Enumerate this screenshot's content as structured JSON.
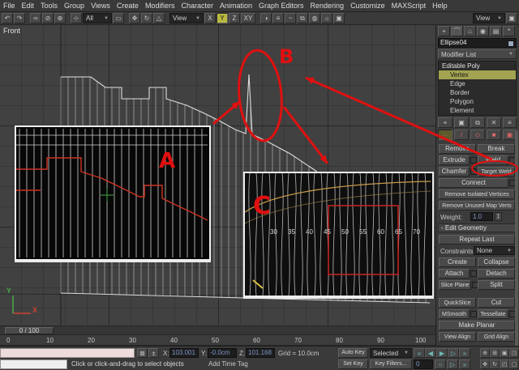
{
  "menu": {
    "items": [
      "File",
      "Edit",
      "Tools",
      "Group",
      "Views",
      "Create",
      "Modifiers",
      "Character",
      "Animation",
      "Graph Editors",
      "Rendering",
      "Customize",
      "MAXScript",
      "Help"
    ]
  },
  "toolbar": {
    "selection_filter": "All",
    "ref_coord": "View",
    "axis_x": "X",
    "axis_y": "Y",
    "axis_z": "Z",
    "axis_xy": "XY",
    "view_right": "View"
  },
  "viewport": {
    "label": "Front",
    "axis_x_label": "X",
    "axis_y_label": "Y",
    "ruler_numbers": [
      "30",
      "35",
      "40",
      "45",
      "50",
      "55",
      "60",
      "65",
      "70"
    ]
  },
  "annotations": {
    "letter_a": "A",
    "letter_b": "B",
    "letter_c": "C"
  },
  "command_panel": {
    "object_name": "Ellipse04",
    "modifier_list_label": "Modifier List",
    "stack": {
      "items": [
        "Editable Poly",
        "Vertex",
        "Edge",
        "Border",
        "Polygon",
        "Element"
      ]
    },
    "edit_vertices": {
      "remove": "Remove",
      "break_btn": "Break",
      "extrude": "Extrude",
      "weld": "Weld",
      "chamfer": "Chamfer",
      "target_weld": "Target Weld",
      "connect": "Connect",
      "remove_isolated": "Remove Isolated Vertices",
      "remove_unused": "Remove Unused Map Verts",
      "weight_label": "Weight:",
      "weight_value": "1.0"
    },
    "edit_geometry": {
      "header": "- Edit Geometry",
      "repeat_last": "Repeat Last",
      "constraints_label": "Constraints:",
      "constraints_value": "None",
      "create": "Create",
      "collapse": "Collapse",
      "attach": "Attach",
      "detach": "Detach",
      "slice_plane": "Slice Plane",
      "split": "Split",
      "quickslice": "QuickSlice",
      "cut": "Cut",
      "msmooth": "MSmooth",
      "tessellate": "Tessellate",
      "make_planar": "Make Planar",
      "view_align": "View Align",
      "grid_align": "Grid Align"
    }
  },
  "timeline": {
    "slider_label": "0 / 100",
    "ticks": [
      "0",
      "10",
      "20",
      "30",
      "40",
      "50",
      "60",
      "70",
      "80",
      "90",
      "100"
    ]
  },
  "status_bar": {
    "x_label": "X:",
    "x_value": "103.001",
    "y_label": "Y:",
    "y_value": "-0.0cm",
    "z_label": "Z:",
    "z_value": "101.168",
    "grid_label": "Grid = 10.0cm",
    "prompt": "Click or click-and-drag to select objects",
    "add_time_tag": "Add Time Tag",
    "auto_key": "Auto Key",
    "selected_filter": "Selected",
    "set_key": "Set Key",
    "key_filters": "Key Filters...",
    "current_frame": "0"
  },
  "icons": {
    "undo": "↶",
    "redo": "↷",
    "link": "∞",
    "unlink": "⊘",
    "bind": "⊕",
    "select": "⊹",
    "region": "▭",
    "move": "✥",
    "rotate": "↻",
    "scale": "△",
    "mirror": "◑",
    "align": "≡",
    "curve_editor": "~",
    "schematic": "⧉",
    "material_editor": "◍",
    "render_setup": "☼",
    "render": "▣",
    "dropdown": "▼",
    "tab_create": "+",
    "tab_modify": "⌒",
    "tab_hierarchy": "⌂",
    "tab_motion": "◉",
    "tab_display": "▤",
    "tab_utilities": "*",
    "pin": "⌖",
    "show_end": "▣",
    "unique": "⧉",
    "remove_mod": "✕",
    "configure": "≡",
    "vertex": "∴",
    "edge": "/",
    "border": "◇",
    "polygon": "■",
    "element": "▣",
    "lock": "⊠",
    "offset": "±",
    "go_start": "«",
    "prev": "◀",
    "play": "▶",
    "next": "▷",
    "go_end": "»",
    "key_dot": "○",
    "zoom": "⊕",
    "zoom_all": "⊞",
    "zoom_extents": "▣",
    "zoom_region": "◳",
    "pan": "✥",
    "orbit": "↻",
    "fov": "◰",
    "min_max": "▢",
    "spin_up": "▲",
    "spin_down": "▼"
  },
  "colors": {
    "annotation": "#e01010",
    "axis_highlight": "#b9b942"
  }
}
